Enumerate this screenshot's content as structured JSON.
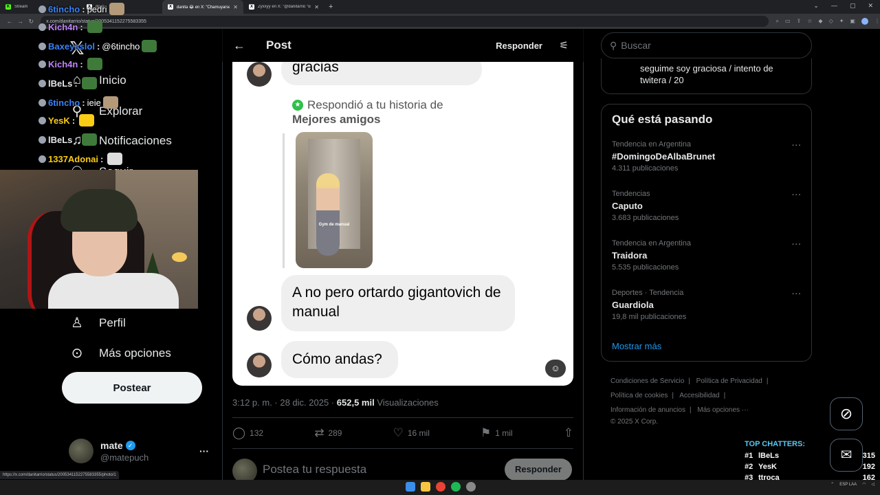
{
  "browser": {
    "tabs": [
      {
        "title": "Stream",
        "favicon": "kick-icon"
      },
      {
        "title": "de la",
        "favicon": "x-icon"
      },
      {
        "title": "danita 😂 en X: \"Chamuyarse p",
        "favicon": "x-icon"
      },
      {
        "title": "Zyxxyy en X: \"@danitarrio \"orn",
        "favicon": "x-icon"
      }
    ],
    "url": "x.com/danitarrio/status/2005341152275583355",
    "status_url": "https://x.com/danitarrio/status/2005341152275583355/photo/1"
  },
  "chat": [
    {
      "user": "6tincho",
      "color": "#3b82f6",
      "text": "pedri",
      "emote": "#b59a7a"
    },
    {
      "user": "Kich4n",
      "color": "#c084fc",
      "text": "",
      "emote": "#3f7a3a"
    },
    {
      "user": "Baxeysslol",
      "color": "#3b82f6",
      "text": "@6tincho",
      "emote": "#3f7a3a"
    },
    {
      "user": "Kich4n",
      "color": "#c084fc",
      "text": "",
      "emote": "#3f7a3a"
    },
    {
      "user": "lBeLs",
      "color": "#e5e7eb",
      "text": "",
      "emote": "#3f7a3a"
    },
    {
      "user": "6tincho",
      "color": "#3b82f6",
      "text": "ieie",
      "emote": "#b59a7a"
    },
    {
      "user": "YesK",
      "color": "#facc15",
      "text": "",
      "emote": "#facc15"
    },
    {
      "user": "lBeLs",
      "color": "#e5e7eb",
      "text": "",
      "emote": "#3f7a3a"
    },
    {
      "user": "1337Adonai",
      "color": "#facc15",
      "text": "",
      "emote": "#dddddd"
    }
  ],
  "nav": {
    "home": "Inicio",
    "explore": "Explorar",
    "notifications": "Notificaciones",
    "follow": "Seguir",
    "profile": "Perfil",
    "more": "Más opciones",
    "post_button": "Postear"
  },
  "account": {
    "name": "mate",
    "handle": "@matepuch"
  },
  "post": {
    "header_title": "Post",
    "header_reply": "Responder",
    "image": {
      "bubble_top": "gracias",
      "story_reply": "Respondió a tu historia de",
      "story_sub": "Mejores amigos",
      "thumb_caption": "Gym de manual",
      "bubble_1": "A no pero ortardo gigantovich de manual",
      "bubble_2": "Cómo andas?"
    },
    "time": "3:12 p. m. · 28 dic. 2025 ·",
    "views_count": "652,5 mil",
    "views_label": "Visualizaciones",
    "replies": "132",
    "reposts": "289",
    "likes": "16 mil",
    "bookmarks": "1 mil",
    "reply_placeholder": "Postea tu respuesta",
    "reply_button": "Responder"
  },
  "sidebar": {
    "search_placeholder": "Buscar",
    "top_card_text": "seguime soy graciosa / intento de twitera / 20",
    "trends_title": "Qué está pasando",
    "trends": [
      {
        "context": "Tendencia en Argentina",
        "name": "#DomingoDeAlbaBrunet",
        "count": "4.311 publicaciones"
      },
      {
        "context": "Tendencias",
        "name": "Caputo",
        "count": "3.683 publicaciones"
      },
      {
        "context": "Tendencia en Argentina",
        "name": "Traidora",
        "count": "5.535 publicaciones"
      },
      {
        "context": "Deportes · Tendencia",
        "name": "Guardiola",
        "count": "19,8 mil publicaciones"
      }
    ],
    "show_more": "Mostrar más",
    "footer": {
      "terms": "Condiciones de Servicio",
      "privacy": "Política de Privacidad",
      "cookies": "Política de cookies",
      "accessibility": "Accesibilidad",
      "ads": "Información de anuncios",
      "more": "Más opciones ···",
      "copyright": "© 2025 X Corp."
    }
  },
  "top_chatters": {
    "title": "TOP CHATTERS:",
    "rows": [
      {
        "rank": "#1",
        "name": "lBeLs",
        "points": "315"
      },
      {
        "rank": "#2",
        "name": "YesK",
        "points": "192"
      },
      {
        "rank": "#3",
        "name": "ttroca",
        "points": "162"
      }
    ]
  },
  "taskbar": {
    "lang": "ESP",
    "lang_sub": "LAA"
  }
}
